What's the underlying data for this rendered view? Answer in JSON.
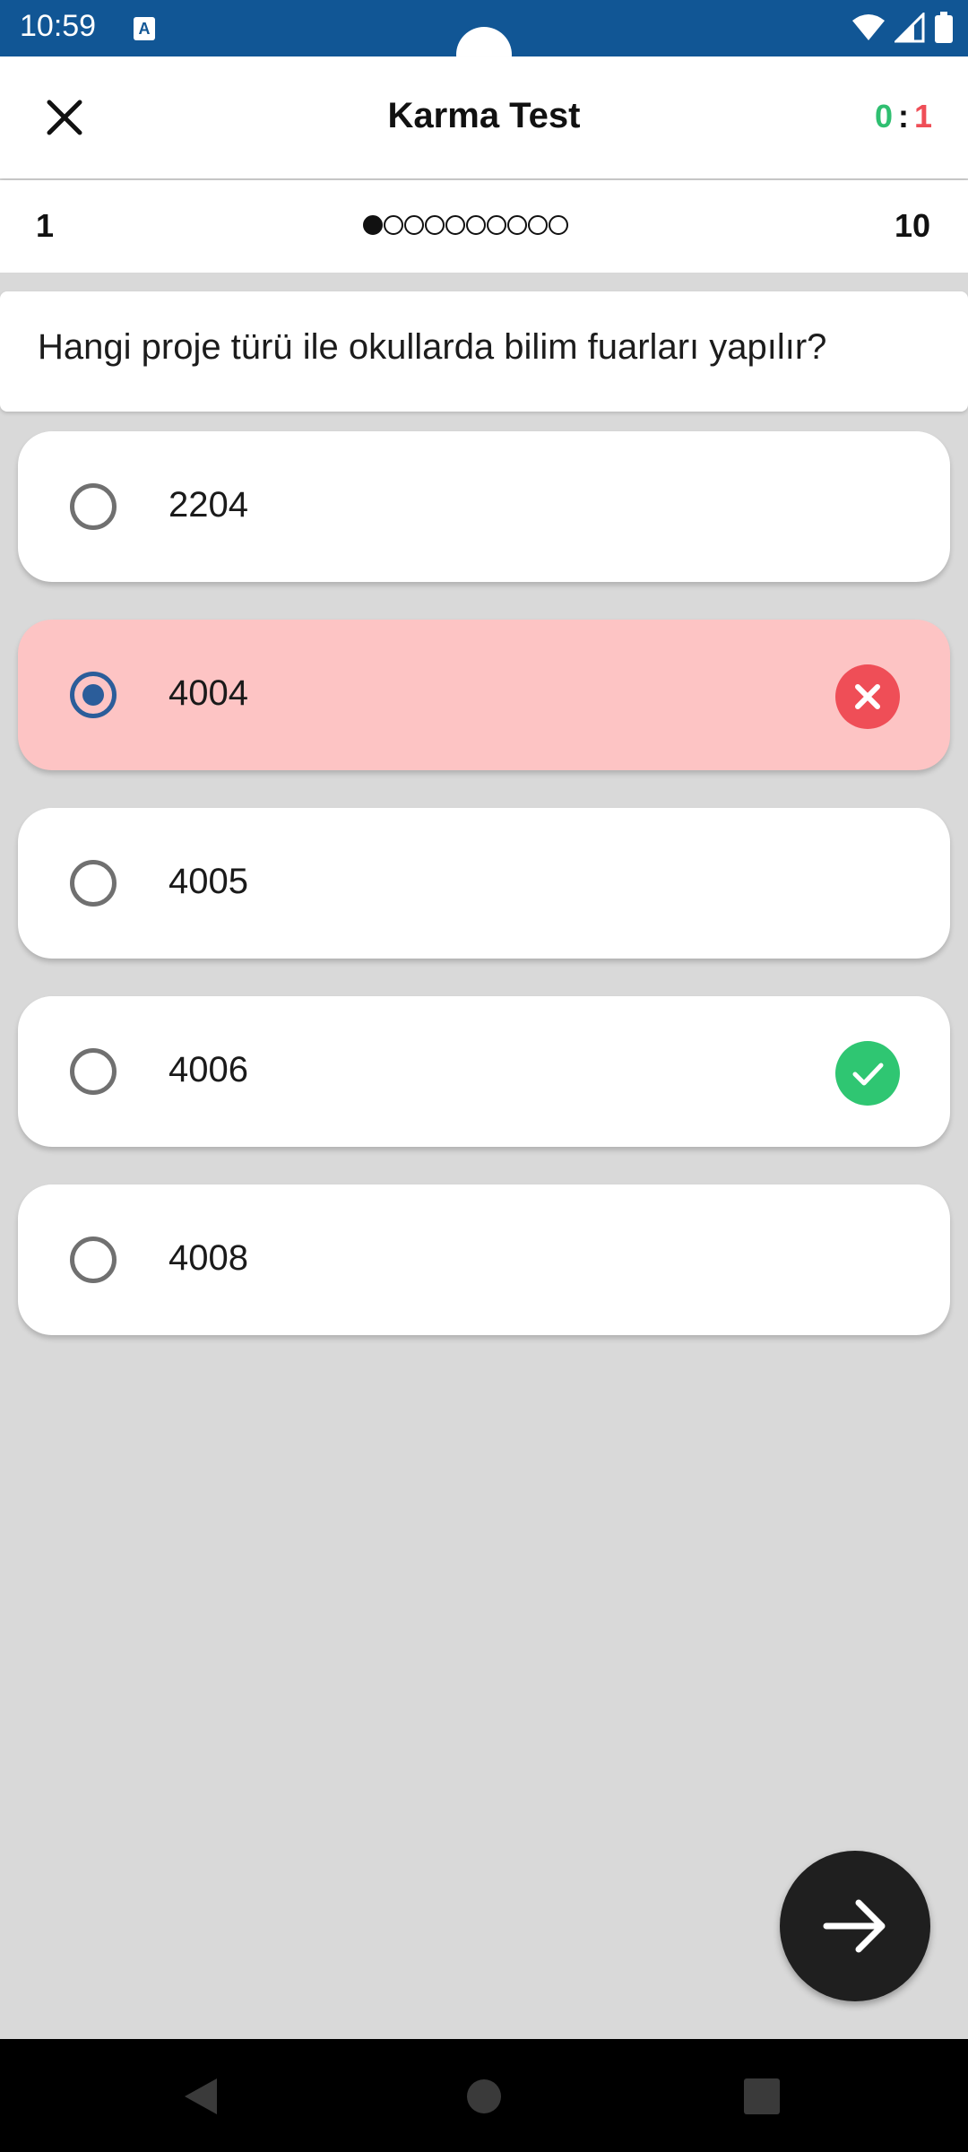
{
  "status_bar": {
    "time": "10:59",
    "notification_icon": "A",
    "icons": [
      "wifi-icon",
      "signal-icon",
      "battery-icon"
    ],
    "background_color": "#115695"
  },
  "app_bar": {
    "close_icon": "close-icon",
    "title": "Karma Test",
    "score": {
      "correct": "0",
      "separator": ":",
      "wrong": "1"
    },
    "correct_color": "#2fbf71",
    "wrong_color": "#ef4e57"
  },
  "progress": {
    "start_label": "1",
    "end_label": "10",
    "total_questions": 10,
    "current_question": 1
  },
  "question": {
    "text": "Hangi proje türü ile okullarda bilim fuarları yapılır?"
  },
  "options": [
    {
      "label": "2204",
      "selected": false,
      "state": "normal"
    },
    {
      "label": "4004",
      "selected": true,
      "state": "wrong"
    },
    {
      "label": "4005",
      "selected": false,
      "state": "normal"
    },
    {
      "label": "4006",
      "selected": false,
      "state": "correct"
    },
    {
      "label": "4008",
      "selected": false,
      "state": "normal"
    }
  ],
  "next_button": {
    "icon": "arrow-right-icon"
  },
  "nav_bar": {
    "icons": [
      "back-icon",
      "home-icon",
      "recents-icon"
    ]
  }
}
